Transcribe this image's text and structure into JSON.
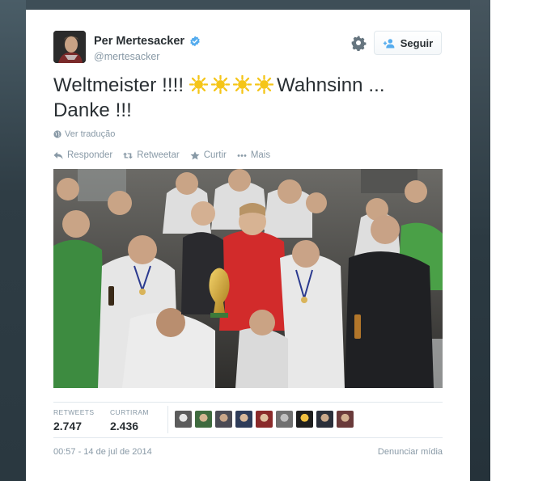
{
  "tweet": {
    "author_name": "Per Mertesacker",
    "handle": "@mertesacker",
    "text_part1": "Weltmeister !!!!",
    "text_part2": "Wahnsinn ...",
    "text_part3": "Danke !!!",
    "emoji_count": 4,
    "emoji_name": "sun-emoji",
    "translate_label": "Ver tradução",
    "follow_label": "Seguir",
    "actions": {
      "reply": "Responder",
      "retweet": "Retweetar",
      "favorite": "Curtir",
      "more": "Mais"
    },
    "stats": {
      "retweets_label": "RETWEETS",
      "retweets_value": "2.747",
      "favorites_label": "CURTIRAM",
      "favorites_value": "2.436"
    },
    "favoriter_avatar_count": 9,
    "timestamp": "00:57 - 14 de jul de 2014",
    "report_label": "Denunciar mídia"
  },
  "colors": {
    "text": "#292f33",
    "muted": "#8899a6",
    "verified": "#55acee",
    "follow_icon": "#55acee",
    "sun": "#f5c518"
  },
  "icons": {
    "verified": "verified-badge-icon",
    "settings": "gear-icon",
    "follow": "add-user-icon",
    "translate": "globe-icon",
    "reply": "reply-icon",
    "retweet": "retweet-icon",
    "favorite": "star-icon",
    "more": "more-dots-icon"
  }
}
